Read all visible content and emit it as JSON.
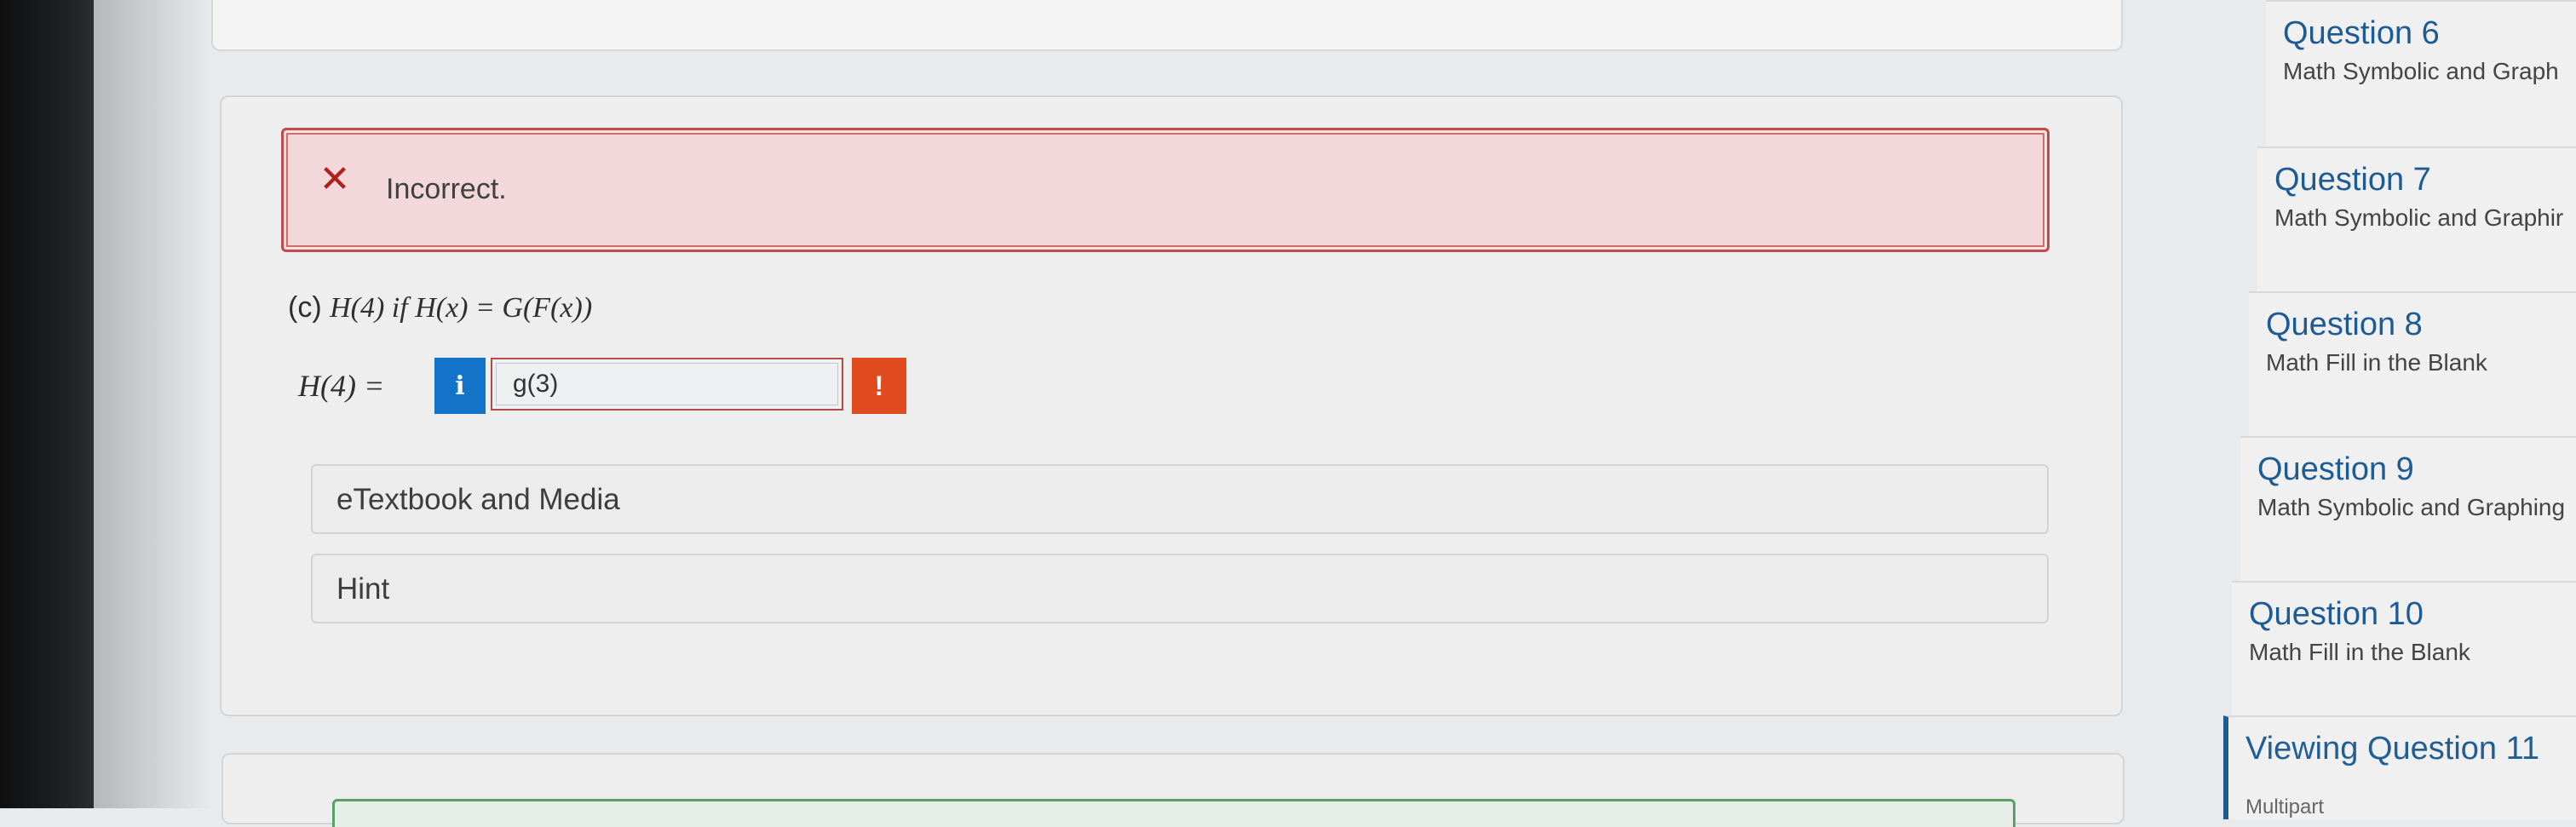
{
  "alert": {
    "icon": "x-mark-icon",
    "text": "Incorrect."
  },
  "question": {
    "part_label": "(c)",
    "statement_math": "H(4) if H(x) = G(F(x))"
  },
  "answer": {
    "lhs": "H(4) =",
    "info_button": "i",
    "value": "g(3)",
    "warning_button": "!"
  },
  "resources": {
    "etextbook_label": "eTextbook and Media",
    "hint_label": "Hint"
  },
  "question_list": [
    {
      "title": "Question 6",
      "subtitle": "Math Symbolic and Graph"
    },
    {
      "title": "Question 7",
      "subtitle": "Math Symbolic and Graphir"
    },
    {
      "title": "Question 8",
      "subtitle": "Math Fill in the Blank"
    },
    {
      "title": "Question 9",
      "subtitle": "Math Symbolic and Graphing"
    },
    {
      "title": "Question 10",
      "subtitle": "Math Fill in the Blank"
    },
    {
      "title": "Viewing Question 11",
      "subtitle": "Multipart"
    }
  ],
  "colors": {
    "accent": "#1e5b93",
    "error": "#b11f1f",
    "info": "#1273c9",
    "warning": "#df4a1f"
  }
}
